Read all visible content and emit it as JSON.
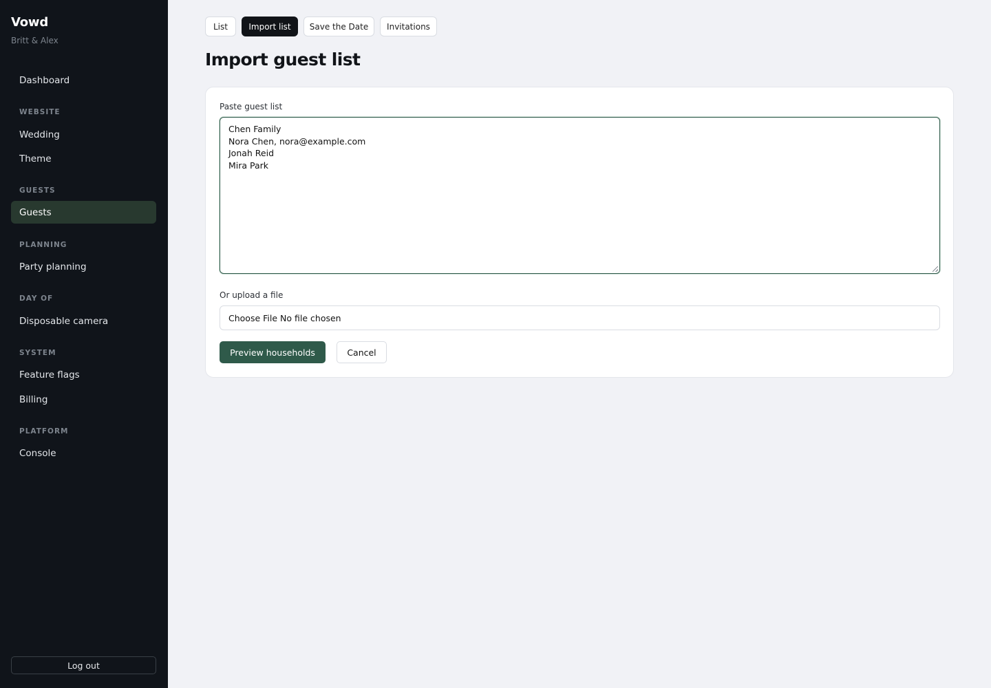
{
  "sidebar": {
    "brand": "Vowd",
    "subtitle": "Britt & Alex",
    "dashboard": "Dashboard",
    "sections": {
      "website": "WEBSITE",
      "guests": "GUESTS",
      "planning": "PLANNING",
      "day_of": "DAY OF",
      "system": "SYSTEM",
      "platform": "PLATFORM"
    },
    "items": {
      "wedding": "Wedding",
      "theme": "Theme",
      "guests": "Guests",
      "party_planning": "Party planning",
      "disposable_camera": "Disposable camera",
      "feature_flags": "Feature flags",
      "billing": "Billing",
      "console": "Console"
    },
    "active": "Guests",
    "logout": "Log out"
  },
  "tabs": {
    "list": "List",
    "import_list": "Import list",
    "save_the_date": "Save the Date",
    "invitations": "Invitations",
    "active": "Import list"
  },
  "page": {
    "title": "Import guest list"
  },
  "form": {
    "paste_label": "Paste guest list",
    "paste_value": "Chen Family\nNora Chen, nora@example.com\nJonah Reid\nMira Park",
    "upload_label": "Or upload a file",
    "file_button": "Choose File",
    "file_status": "No file chosen",
    "preview_button": "Preview households",
    "cancel_button": "Cancel"
  },
  "colors": {
    "sidebar_bg": "#10141a",
    "accent": "#2f5a4a",
    "active_nav_bg": "#28392f",
    "page_bg": "#f1f2f6"
  }
}
